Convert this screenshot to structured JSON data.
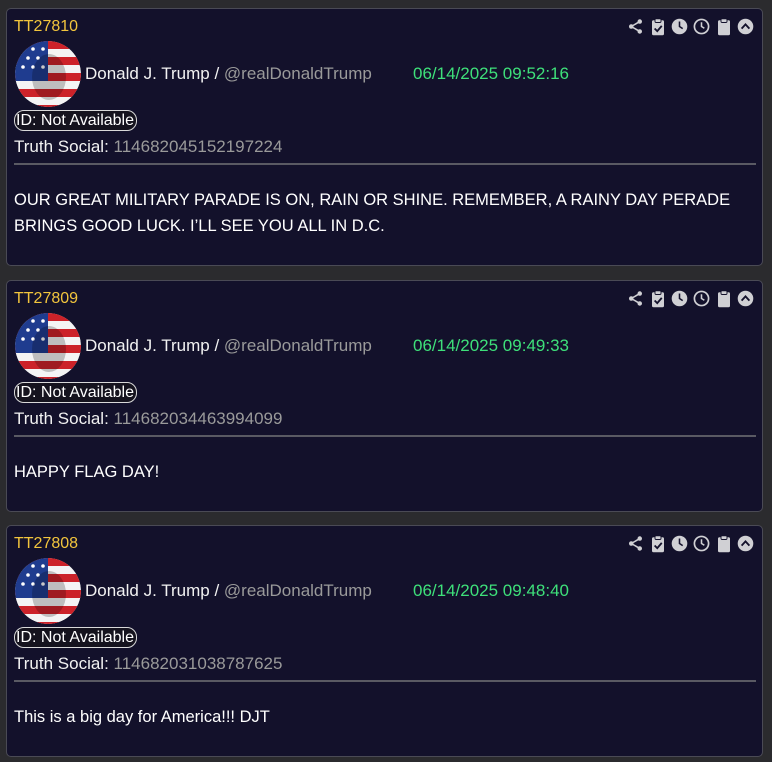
{
  "colors": {
    "background": "#2b2b2e",
    "card_background": "#13112b",
    "card_id": "#f2c53d",
    "timestamp": "#3ee07a",
    "muted_text": "#9a9a9a",
    "icon": "#d0d0d4"
  },
  "toolbar_icons": [
    "share-icon",
    "clipboard-check-icon",
    "clock-filled-icon",
    "clock-outline-icon",
    "clipboard-icon",
    "chevron-up-circle-icon"
  ],
  "posts": [
    {
      "id": "TT27810",
      "author_name": "Donald J. Trump",
      "separator": " / ",
      "handle": "@realDonaldTrump",
      "timestamp": "06/14/2025 09:52:16",
      "id_pill": "ID: Not Available",
      "source_label": "Truth Social: ",
      "source_number": "114682045152197224",
      "text": "OUR GREAT MILITARY PARADE IS ON, RAIN OR SHINE. REMEMBER, A RAINY DAY PERADE BRINGS GOOD LUCK. I’LL SEE YOU ALL IN D.C."
    },
    {
      "id": "TT27809",
      "author_name": "Donald J. Trump",
      "separator": " / ",
      "handle": "@realDonaldTrump",
      "timestamp": "06/14/2025 09:49:33",
      "id_pill": "ID: Not Available",
      "source_label": "Truth Social: ",
      "source_number": "114682034463994099",
      "text": "HAPPY FLAG DAY!"
    },
    {
      "id": "TT27808",
      "author_name": "Donald J. Trump",
      "separator": " / ",
      "handle": "@realDonaldTrump",
      "timestamp": "06/14/2025 09:48:40",
      "id_pill": "ID: Not Available",
      "source_label": "Truth Social: ",
      "source_number": "114682031038787625",
      "text": "This is a big day for America!!! DJT"
    }
  ]
}
